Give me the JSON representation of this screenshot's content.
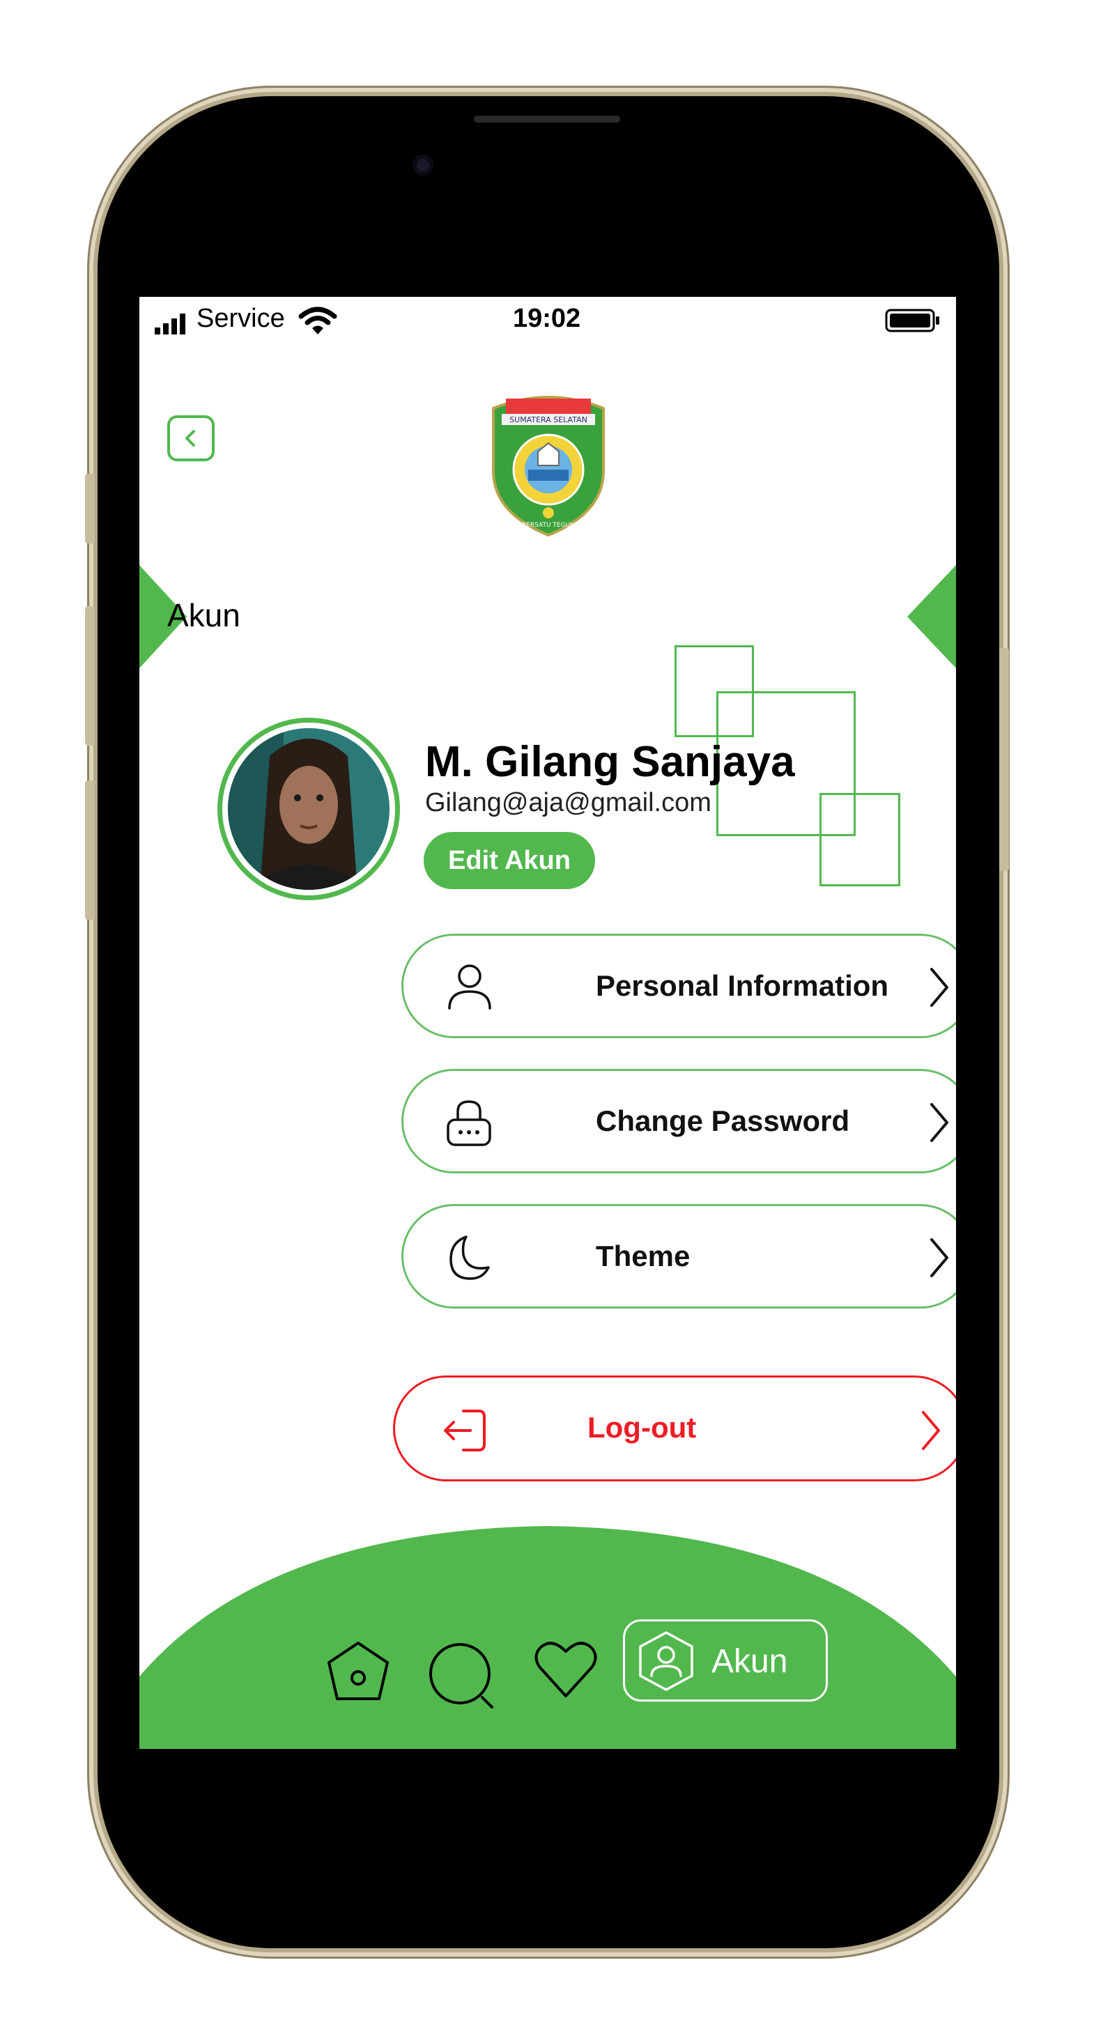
{
  "status_bar": {
    "carrier": "Service",
    "time": "19:02"
  },
  "header": {
    "title": "Akun"
  },
  "profile": {
    "name": "M. Gilang Sanjaya",
    "email": "Gilang@aja@gmail.com",
    "edit_label": "Edit Akun"
  },
  "menu": {
    "items": [
      {
        "label": "Personal Information",
        "icon": "user-icon"
      },
      {
        "label": "Change Password",
        "icon": "lock-icon"
      },
      {
        "label": "Theme",
        "icon": "moon-icon"
      }
    ],
    "logout_label": "Log-out"
  },
  "bottom_nav": {
    "items": [
      "home-icon",
      "search-icon",
      "heart-icon",
      "profile-icon"
    ],
    "active_label": "Akun"
  },
  "colors": {
    "accent": "#52b84e",
    "danger": "#ee1c24",
    "frame_gold": "#d9ccb0"
  }
}
